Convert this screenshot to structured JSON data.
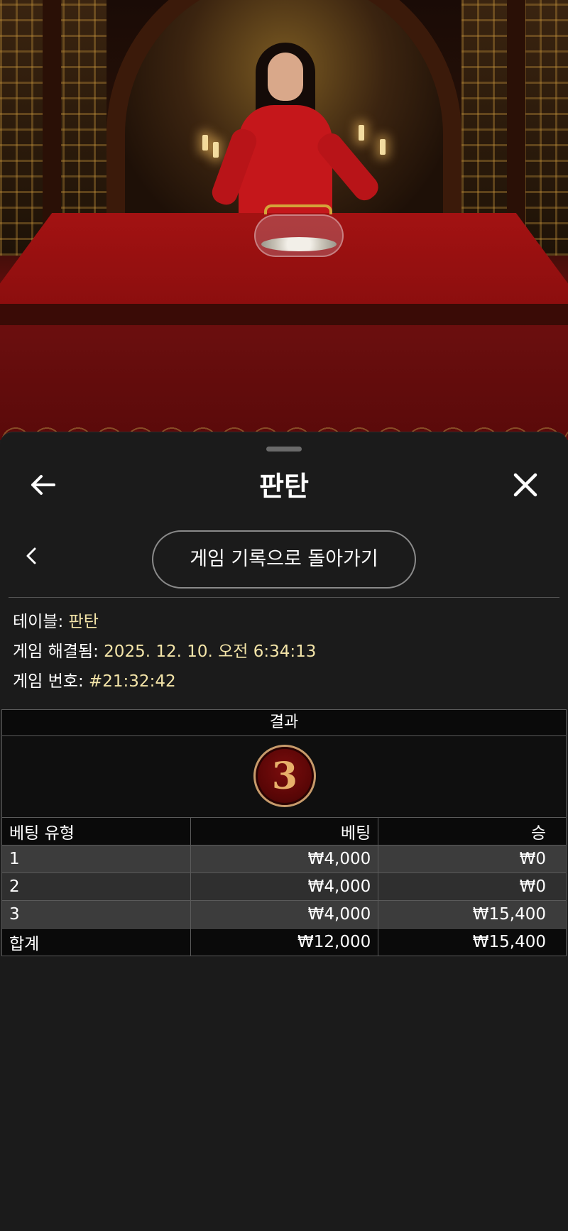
{
  "sheet": {
    "title": "판탄",
    "back_icon": "arrow-left-icon",
    "close_icon": "close-icon"
  },
  "nav": {
    "prev_icon": "chevron-left-icon",
    "back_to_history": "게임 기록으로 돌아가기"
  },
  "info": {
    "table_label": "테이블: ",
    "table_value": "판탄",
    "resolved_label": "게임 해결됨: ",
    "resolved_value": "2025. 12. 10. 오전 6:34:13",
    "game_no_label": "게임 번호: ",
    "game_no_value": "#21:32:42"
  },
  "result": {
    "header": "결과",
    "value": "3"
  },
  "bets": {
    "headers": [
      "베팅 유형",
      "베팅",
      "승"
    ],
    "rows": [
      [
        "1",
        "₩4,000",
        "₩0"
      ],
      [
        "2",
        "₩4,000",
        "₩0"
      ],
      [
        "3",
        "₩4,000",
        "₩15,400"
      ]
    ],
    "total": [
      "합계",
      "₩12,000",
      "₩15,400"
    ]
  },
  "colors": {
    "sheet_bg": "#1b1b1b",
    "info_value": "#f3e4a8",
    "result_ball": "#5a0606",
    "result_digit": "#e7b06a"
  }
}
